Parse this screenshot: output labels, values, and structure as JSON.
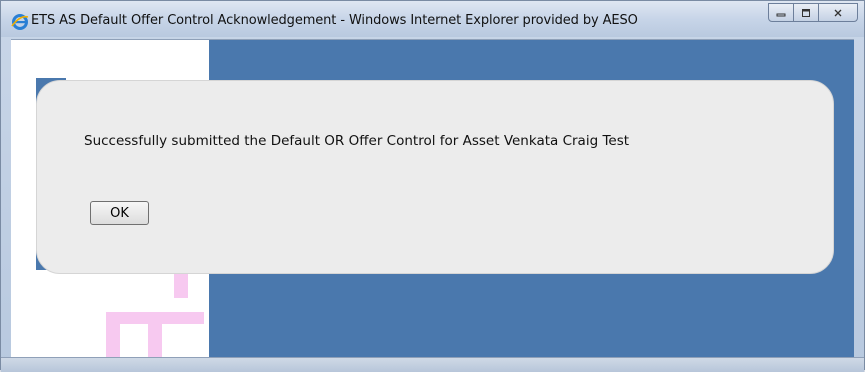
{
  "window": {
    "title": "ETS AS Default Offer Control Acknowledgement - Windows Internet Explorer provided by AESO",
    "minimize_icon": "minimize-icon",
    "maximize_icon": "maximize-icon",
    "close_icon": "close-icon"
  },
  "dialog": {
    "message": "Successfully submitted the Default OR Offer Control for Asset Venkata Craig Test",
    "ok_label": "OK"
  },
  "colors": {
    "blue_panel": "#4a78ad",
    "dialog_bg": "#ececec",
    "pink_logo": "#f7c9f0"
  }
}
